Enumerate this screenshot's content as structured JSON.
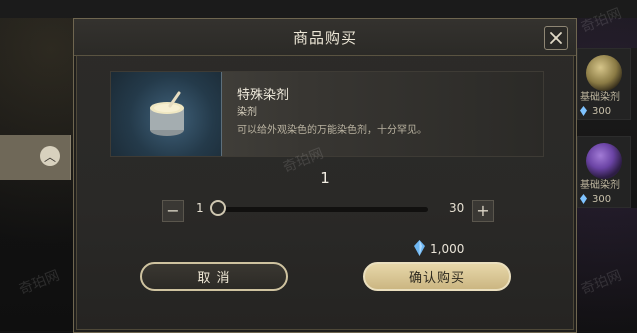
{
  "dialog": {
    "title": "商品购买",
    "close_icon": "close-icon"
  },
  "item": {
    "name": "特殊染剂",
    "type": "染剂",
    "description": "可以给外观染色的万能染色剂，十分罕见。",
    "icon": "dye-bucket-icon"
  },
  "quantity": {
    "current": "1",
    "min": "1",
    "max": "30",
    "fraction": 0.0,
    "minus_icon": "minus-icon",
    "plus_icon": "plus-icon"
  },
  "price": {
    "amount": "1,000",
    "currency_icon": "crystal-icon",
    "accent": "#7fc3ff"
  },
  "buttons": {
    "cancel": "取 消",
    "confirm": "确认购买"
  },
  "background": {
    "side_items": [
      {
        "label": "基础染剂",
        "price": "300"
      },
      {
        "label": "基础染剂",
        "price": "300"
      }
    ]
  },
  "watermark": "奇珀网"
}
